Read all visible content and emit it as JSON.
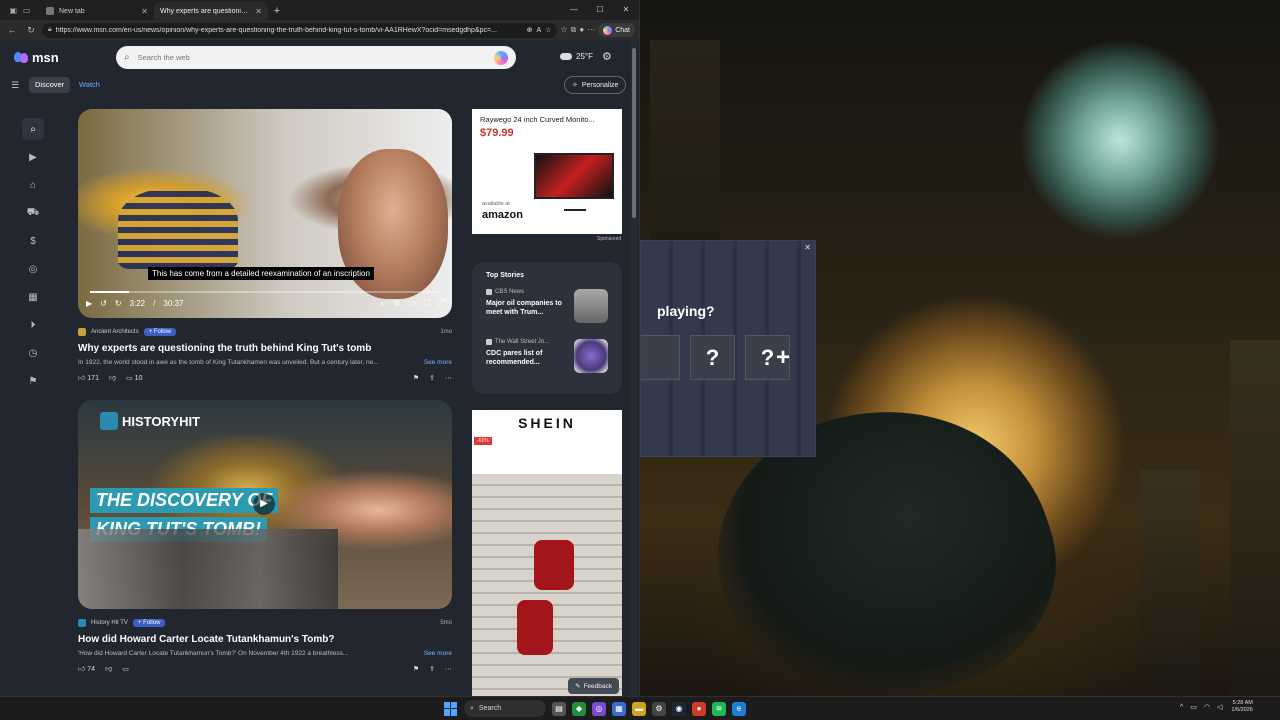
{
  "browser": {
    "tabs": [
      {
        "title": "New tab",
        "active": false
      },
      {
        "title": "Why experts are questioning the truth behind King Tut's tomb",
        "active": true
      }
    ],
    "url": "https://www.msn.com/en-us/news/opinion/why-experts-are-questioning-the-truth-behind-king-tut-s-tomb/vi-AA1RHewX?ocid=msedgdhp&pc=...",
    "chat_label": "Chat"
  },
  "msn": {
    "logo": "msn",
    "search_placeholder": "Search the web",
    "weather_temp": "25°F",
    "subnav": {
      "discover": "Discover",
      "watch": "Watch",
      "personalize": "Personalize"
    },
    "rail_icons": [
      "search-icon",
      "video-icon",
      "shopping-icon",
      "car-icon",
      "money-icon",
      "sports-icon",
      "calendar-icon",
      "play-icon",
      "history-icon",
      "bookmark-icon"
    ],
    "card1": {
      "caption": "This has come from a detailed reexamination of an inscription",
      "time_current": "3:22",
      "time_sep": "/",
      "time_total": "30:37",
      "progress": 0.11,
      "source": "Ancient Architects",
      "follow": "+ Follow",
      "age": "1mo",
      "title": "Why experts are questioning the truth behind King Tut's tomb",
      "snippet": "In 1922, the world stood in awe as the tomb of King Tutankhamen was unveiled. But a century later, ne...",
      "see_more": "See more",
      "likes": "171",
      "comments": "10"
    },
    "card2": {
      "brand": "HISTORYHIT",
      "overlay_line1": "THE DISCOVERY OF",
      "overlay_line2": "KING TUT'S TOMB!",
      "source": "History Hit TV",
      "follow": "+ Follow",
      "age": "5mo",
      "title": "How did Howard Carter Locate Tutankhamun's Tomb?",
      "snippet": "'How did Howard Carter Locate Tutankhamun's Tomb?' On November 4th 1922 a breathless...",
      "see_more": "See more",
      "likes": "74"
    },
    "ad1": {
      "title": "Raywego 24 inch Curved Monito...",
      "price": "$79.99",
      "available": "available at",
      "store": "amazon",
      "sponsored": "Sponsored"
    },
    "top_stories": {
      "heading": "Top Stories",
      "items": [
        {
          "source": "CBS News",
          "headline": "Major oil companies to meet with Trum..."
        },
        {
          "source": "The Wall Street Jo...",
          "headline": "CDC pares list of recommended..."
        }
      ]
    },
    "ad2": {
      "brand": "SHEIN",
      "badge": "-61%"
    },
    "feedback": "Feedback"
  },
  "dialog": {
    "title": "playing?",
    "slots": [
      "?",
      "?"
    ],
    "add": "+"
  },
  "taskbar": {
    "search": "Search",
    "time": "5:28 AM",
    "date": "1/6/2026"
  },
  "colors": {
    "accent": "#3b5fc4",
    "link": "#7ab6ff",
    "page_bg": "#22262e"
  }
}
